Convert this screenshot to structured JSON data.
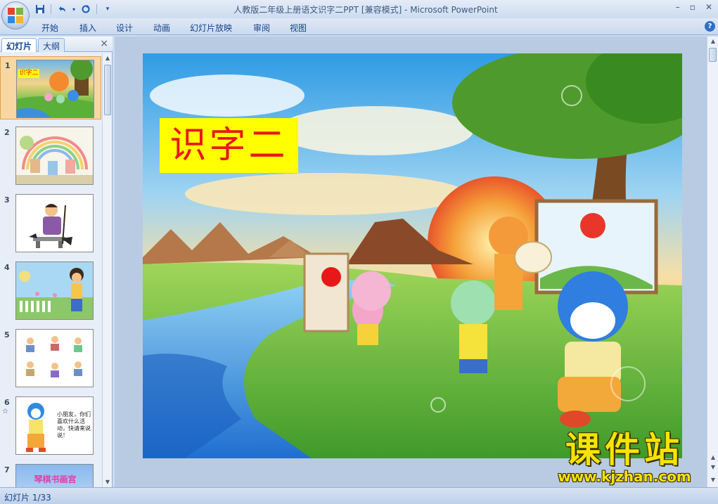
{
  "window": {
    "title": "人教版二年级上册语文识字二PPT [兼容模式] - Microsoft PowerPoint",
    "controls": [
      "minimize-icon",
      "restore-icon",
      "close-icon"
    ]
  },
  "quick_access": {
    "items": [
      "save-icon",
      "undo-icon",
      "redo-icon",
      "customize-icon"
    ]
  },
  "ribbon": {
    "tabs": [
      {
        "label": "开始"
      },
      {
        "label": "插入"
      },
      {
        "label": "设计"
      },
      {
        "label": "动画"
      },
      {
        "label": "幻灯片放映"
      },
      {
        "label": "审阅"
      },
      {
        "label": "视图"
      }
    ],
    "help": "?"
  },
  "left_panel": {
    "tabs": [
      {
        "label": "幻灯片",
        "active": true
      },
      {
        "label": "大纲",
        "active": false
      }
    ],
    "close": "×",
    "slides": [
      {
        "num": "1",
        "selected": true,
        "thumb_title": "识字二"
      },
      {
        "num": "2",
        "selected": false
      },
      {
        "num": "3",
        "selected": false
      },
      {
        "num": "4",
        "selected": false
      },
      {
        "num": "5",
        "selected": false
      },
      {
        "num": "6",
        "selected": false,
        "anim": "☆",
        "thumb_text": "小朋友，你们喜欢什么活动，快请来说说！"
      },
      {
        "num": "7",
        "selected": false,
        "thumb_text": "琴棋书画宫"
      }
    ]
  },
  "slide": {
    "title": "识字二"
  },
  "status": {
    "slide_counter": "幻灯片 1/33"
  },
  "watermark": {
    "main": "课件站",
    "url": "www.kjzhan.com"
  },
  "colors": {
    "title_box_bg": "#ffff00",
    "title_text": "#e81818",
    "selected_thumb": "#f8d7a3",
    "ribbon_text": "#15428b"
  }
}
